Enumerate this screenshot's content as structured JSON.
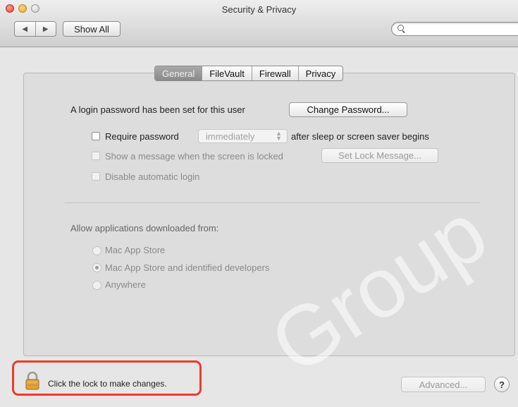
{
  "window": {
    "title": "Security & Privacy"
  },
  "toolbar": {
    "back_glyph": "◀",
    "forward_glyph": "▶",
    "show_all_label": "Show All",
    "search_value": "",
    "search_placeholder": ""
  },
  "tabs": [
    {
      "label": "General",
      "selected": true
    },
    {
      "label": "FileVault",
      "selected": false
    },
    {
      "label": "Firewall",
      "selected": false
    },
    {
      "label": "Privacy",
      "selected": false
    }
  ],
  "general": {
    "login_password_text": "A login password has been set for this user",
    "change_password_label": "Change Password...",
    "require_password": {
      "label": "Require password",
      "checked": false,
      "selected_option": "immediately",
      "suffix": "after sleep or screen saver begins"
    },
    "show_message": {
      "label": "Show a message when the screen is locked",
      "checked": false,
      "button_label": "Set Lock Message..."
    },
    "disable_auto_login": {
      "label": "Disable automatic login",
      "checked": false
    },
    "allow_apps_label": "Allow applications downloaded from:",
    "allow_options": [
      {
        "label": "Mac App Store",
        "selected": false
      },
      {
        "label": "Mac App Store and identified developers",
        "selected": true
      },
      {
        "label": "Anywhere",
        "selected": false
      }
    ]
  },
  "bottom": {
    "lock_text": "Click the lock to make changes.",
    "advanced_label": "Advanced...",
    "help_label": "?"
  },
  "watermark": {
    "text": "Group"
  },
  "colors": {
    "highlight": "#ef3a2e",
    "lock_body": "#e1a23c",
    "selected_tab": "#8f8f8f"
  }
}
